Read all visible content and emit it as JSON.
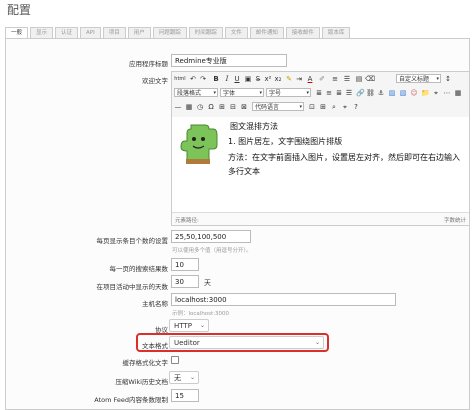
{
  "page": {
    "title": "配置"
  },
  "tabs": [
    {
      "label": "一般"
    },
    {
      "label": "显示"
    },
    {
      "label": "认证"
    },
    {
      "label": "API"
    },
    {
      "label": "项目"
    },
    {
      "label": "用户"
    },
    {
      "label": "问题跟踪"
    },
    {
      "label": "时间跟踪"
    },
    {
      "label": "文件"
    },
    {
      "label": "邮件通知"
    },
    {
      "label": "接收邮件"
    },
    {
      "label": "版本库"
    }
  ],
  "form": {
    "app_title_label": "应用程序标题",
    "app_title_value": "Redmine专业版",
    "welcome_label": "欢迎文字",
    "per_page_label": "每页显示条目个数的设置",
    "per_page_value": "25,50,100,500",
    "per_page_hint": "可以使用多个值（用逗号分开）。",
    "search_limit_label": "每一页的搜索结果数",
    "search_limit_value": "10",
    "activity_days_label": "在项目活动中显示的天数",
    "activity_days_value": "30",
    "activity_days_unit": "天",
    "host_label": "主机名称",
    "host_value": "localhost:3000",
    "host_hint": "示例：localhost:3000",
    "protocol_label": "协议",
    "protocol_value": "HTTP",
    "text_format_label": "文本格式",
    "text_format_value": "Ueditor",
    "cache_label": "缓存格式化文字",
    "wiki_compress_label": "压缩Wiki历史文档",
    "wiki_compress_value": "无",
    "feed_limit_label": "Atom Feed内容条数限制",
    "feed_limit_value": "15"
  },
  "editor": {
    "toolbar_row1": {
      "html": "html",
      "bold": "B",
      "italic": "I",
      "underline": "U",
      "font_color": "A",
      "custom_title": "自定义标题"
    },
    "toolbar_row2": {
      "paragraph_format": "段落格式",
      "font_family": "字体",
      "font_size": "字号"
    },
    "toolbar_row3": {
      "code_language": "代码语言"
    },
    "content": {
      "heading": "图文混排方法",
      "line1": "1. 图片居左，文字围绕图片排版",
      "line2": "方法：在文字前面插入图片，设置居左对齐，然后即可在右边输入多行文本"
    },
    "footer_path": "元素路径:",
    "footer_count": "字数统计"
  },
  "colors": {
    "highlight": "#d9302a",
    "tab_bg": "#f0f0f0",
    "border": "#cccccc"
  }
}
